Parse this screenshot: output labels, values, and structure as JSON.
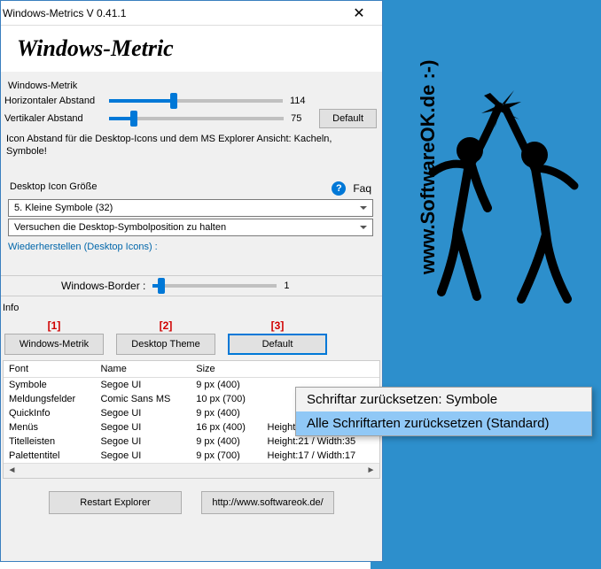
{
  "bg": {
    "website": "www.SoftwareOK.de :-)"
  },
  "window": {
    "title": "Windows-Metrics V 0.41.1",
    "banner": "Windows-Metric"
  },
  "metrik": {
    "group_label": "Windows-Metrik",
    "horiz_label": "Horizontaler Abstand",
    "horiz_value": "114",
    "vert_label": "Vertikaler Abstand",
    "vert_value": "75",
    "default_btn": "Default",
    "desc": "Icon Abstand für die Desktop-Icons und dem MS Explorer Ansicht: Kacheln, Symbole!"
  },
  "iconsize": {
    "group_label": "Desktop Icon Größe",
    "faq": "Faq",
    "selected": "5. Kleine Symbole (32)",
    "hold": "Versuchen die Desktop-Symbolposition zu halten",
    "restore": "Wiederherstellen (Desktop Icons) :"
  },
  "border": {
    "label": "Windows-Border :",
    "value": "1"
  },
  "info": {
    "label": "Info",
    "m1": "[1]",
    "m2": "[2]",
    "m3": "[3]",
    "b1": "Windows-Metrik",
    "b2": "Desktop Theme",
    "b3": "Default"
  },
  "table": {
    "cols": [
      "Font",
      "Name",
      "Size",
      ""
    ],
    "rows": [
      [
        "Symbole",
        "Segoe UI",
        "9 px (400)",
        ""
      ],
      [
        "Meldungsfelder",
        "Comic Sans MS",
        "10 px (700)",
        ""
      ],
      [
        "QuickInfo",
        "Segoe UI",
        "9 px (400)",
        ""
      ],
      [
        "Menüs",
        "Segoe UI",
        "16 px (400)",
        "Height:39 / Width:19"
      ],
      [
        "Titelleisten",
        "Segoe UI",
        "9 px (400)",
        "Height:21 / Width:35"
      ],
      [
        "Palettentitel",
        "Segoe UI",
        "9 px (700)",
        "Height:17 / Width:17"
      ]
    ]
  },
  "bottom": {
    "restart": "Restart Explorer",
    "link": "http://www.softwareok.de/"
  },
  "menu": {
    "i1": "Schriftar zurücksetzen: Symbole",
    "i2": "Alle Schriftarten zurücksetzen (Standard)"
  }
}
